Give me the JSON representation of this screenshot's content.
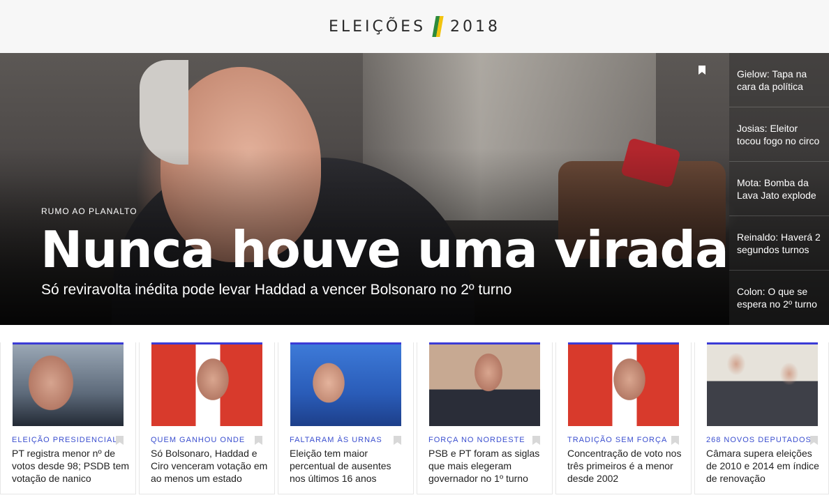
{
  "header": {
    "title_left": "ELEIÇÕES",
    "title_right": "2018"
  },
  "hero": {
    "kicker": "RUMO AO PLANALTO",
    "title": "Nunca houve uma virada",
    "subtitle": "Só reviravolta inédita pode levar Haddad a vencer Bolsonaro no 2º turno"
  },
  "sidebar": {
    "items": [
      {
        "label": "Gielow: Tapa na cara da política"
      },
      {
        "label": "Josias: Eleitor tocou fogo no circo"
      },
      {
        "label": "Mota: Bomba da Lava Jato explode"
      },
      {
        "label": "Reinaldo: Haverá 2 segundos turnos"
      },
      {
        "label": "Colon: O que se espera no 2º turno"
      }
    ]
  },
  "cards": [
    {
      "label": "ELEIÇÃO PRESIDENCIAL",
      "title": "PT registra menor nº de votos desde 98; PSDB tem votação de nanico"
    },
    {
      "label": "QUEM GANHOU ONDE",
      "title": "Só Bolsonaro, Haddad e Ciro venceram votação em ao menos um estado"
    },
    {
      "label": "FALTARAM ÀS URNAS",
      "title": "Eleição tem maior percentual de ausentes nos últimos 16 anos"
    },
    {
      "label": "FORÇA NO NORDESTE",
      "title": "PSB e PT foram as siglas que mais elegeram governador no 1º turno"
    },
    {
      "label": "TRADIÇÃO SEM FORÇA",
      "title": "Concentração de voto nos três primeiros é a menor desde 2002"
    },
    {
      "label": "268 NOVOS DEPUTADOS",
      "title": "Câmara supera eleições de 2010 e 2014 em índice de renovação"
    }
  ],
  "colors": {
    "accent": "#3b3bd6",
    "label": "#3a4ecf",
    "flag_green": "#2e8b3c",
    "flag_yellow": "#f2c40f"
  },
  "icons": [
    "bookmark-icon",
    "flag-stripe-icon"
  ]
}
